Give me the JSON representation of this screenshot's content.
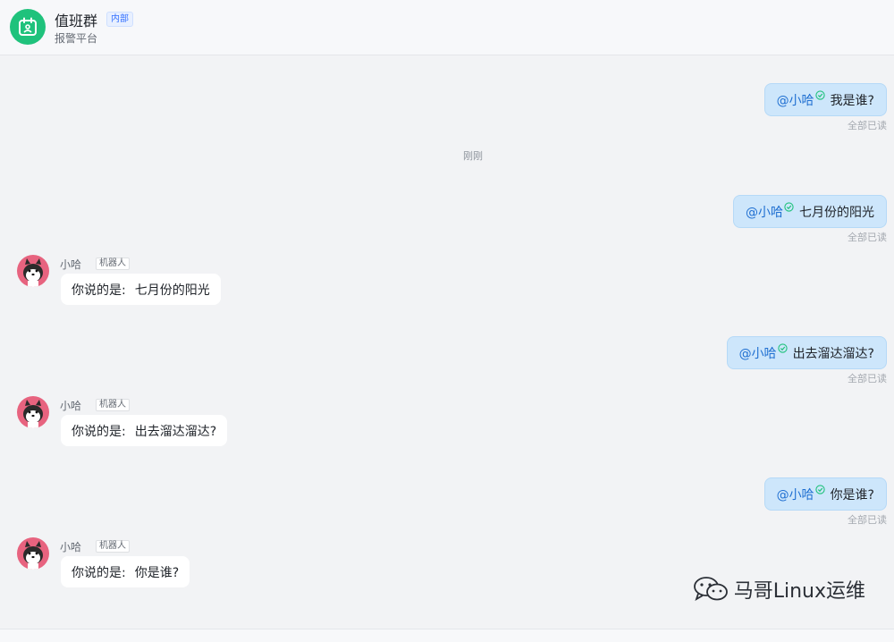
{
  "header": {
    "group_name": "值班群",
    "group_tag": "内部",
    "group_subtitle": "报警平台",
    "avatar_icon": "calendar-icon",
    "avatar_color": "#1fc27c"
  },
  "time_separator": "刚刚",
  "read_label": "全部已读",
  "mention": "@小哈",
  "outgoing": [
    {
      "text": "我是谁?"
    },
    {
      "text": "七月份的阳光"
    },
    {
      "text": "出去溜达溜达?"
    },
    {
      "text": "你是谁?"
    }
  ],
  "incoming": [
    {
      "sender": "小哈",
      "tag": "机器人",
      "prefix": "你说的是:",
      "text": "七月份的阳光"
    },
    {
      "sender": "小哈",
      "tag": "机器人",
      "prefix": "你说的是:",
      "text": "出去溜达溜达?"
    },
    {
      "sender": "小哈",
      "tag": "机器人",
      "prefix": "你说的是:",
      "text": "你是谁?"
    }
  ],
  "watermark": {
    "text": "马哥Linux运维",
    "icon": "wechat-icon"
  },
  "colors": {
    "outgoing_bubble": "#cde6fb",
    "incoming_bubble": "#ffffff",
    "mention": "#1f6fd1",
    "read_check": "#1fc27c"
  }
}
